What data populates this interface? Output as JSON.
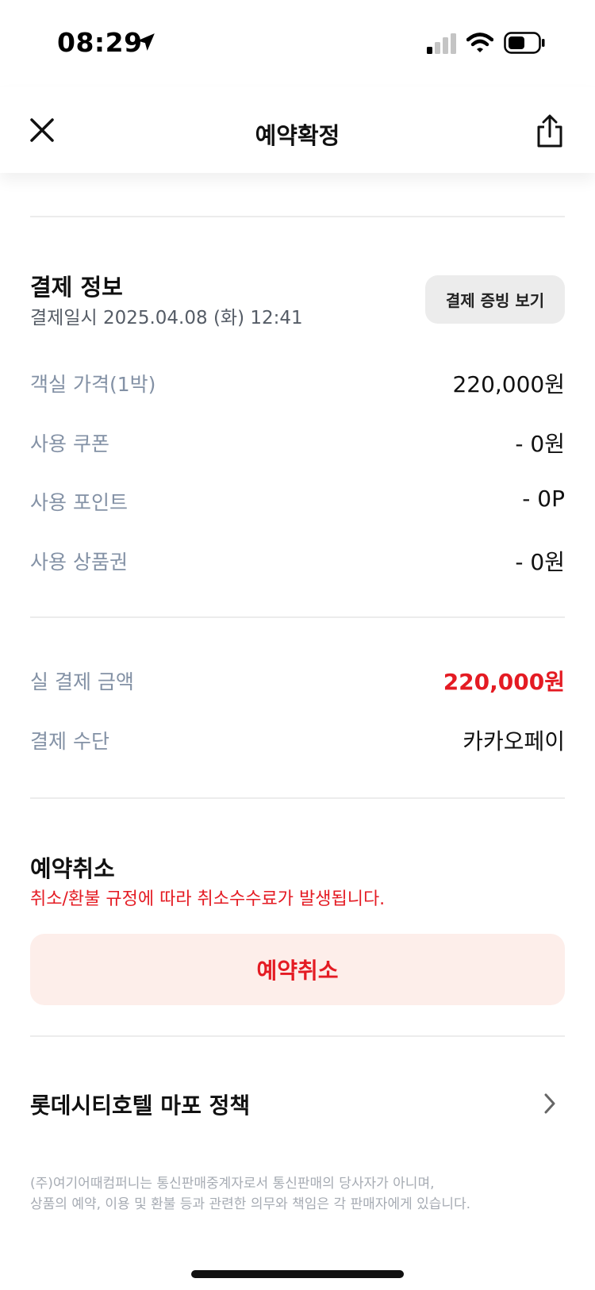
{
  "status_bar": {
    "time": "08:29",
    "icons": [
      "location-arrow-icon",
      "cellular-signal-icon",
      "wifi-icon",
      "battery-icon"
    ]
  },
  "header": {
    "title": "예약확정",
    "close_icon": "close-icon",
    "share_icon": "share-icon"
  },
  "payment": {
    "title": "결제 정보",
    "paid_at": "결제일시 2025.04.08 (화) 12:41",
    "proof_button": "결제 증빙 보기",
    "rows": [
      {
        "label": "객실 가격(1박)",
        "value": "220,000원"
      },
      {
        "label": "사용 쿠폰",
        "value": "- 0원"
      },
      {
        "label": "사용 포인트",
        "value": "- 0P"
      },
      {
        "label": "사용 상품권",
        "value": "- 0원"
      }
    ],
    "total": {
      "label": "실 결제 금액",
      "value": "220,000원"
    },
    "method": {
      "label": "결제 수단",
      "value": "카카오페이"
    }
  },
  "cancellation": {
    "title": "예약취소",
    "note": "취소/환불 규정에 따라 취소수수료가 발생됩니다.",
    "button": "예약취소"
  },
  "policy": {
    "label": "롯데시티호텔 마포 정책",
    "icon": "chevron-right-icon"
  },
  "footer": {
    "line1": "(주)여기어때컴퍼니는 통신판매중계자로서 통신판매의 당사자가 아니며,",
    "line2": "상품의 예약, 이용 및 환불 등과 관련한 의무와 책임은 각 판매자에게 있습니다."
  },
  "colors": {
    "accent_red": "#e41b23",
    "label_gray": "#8391a5",
    "cancel_bg": "#fdeeea",
    "button_bg": "#ececec"
  }
}
